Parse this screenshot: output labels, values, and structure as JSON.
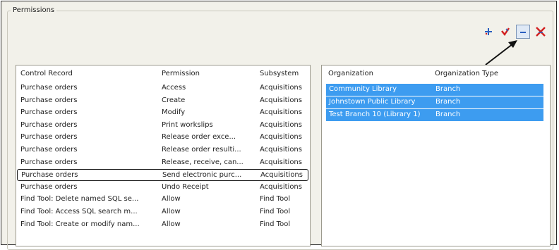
{
  "group": {
    "title": "Permissions"
  },
  "toolbar": {
    "buttons": [
      {
        "name": "add-icon",
        "color": "#2b5fbf"
      },
      {
        "name": "edit-check-icon",
        "color": "#d21f1f"
      },
      {
        "name": "remove-icon",
        "color": "#2b5fbf"
      },
      {
        "name": "delete-all-icon",
        "color": "#d21f1f"
      }
    ]
  },
  "left_table": {
    "columns": [
      "Control Record",
      "Permission",
      "Subsystem"
    ],
    "rows": [
      [
        "Purchase orders",
        "Access",
        "Acquisitions"
      ],
      [
        "Purchase orders",
        "Create",
        "Acquisitions"
      ],
      [
        "Purchase orders",
        "Modify",
        "Acquisitions"
      ],
      [
        "Purchase orders",
        "Print workslips",
        "Acquisitions"
      ],
      [
        "Purchase orders",
        "Release order exce...",
        "Acquisitions"
      ],
      [
        "Purchase orders",
        "Release order resulti...",
        "Acquisitions"
      ],
      [
        "Purchase orders",
        "Release, receive, can...",
        "Acquisitions"
      ],
      [
        "Purchase orders",
        "Send electronic purc...",
        "Acquisitions"
      ],
      [
        "Purchase orders",
        "Undo Receipt",
        "Acquisitions"
      ],
      [
        "Find Tool: Delete named SQL se...",
        "Allow",
        "Find Tool"
      ],
      [
        "Find Tool: Access SQL search m...",
        "Allow",
        "Find Tool"
      ],
      [
        "Find Tool: Create or modify nam...",
        "Allow",
        "Find Tool"
      ]
    ],
    "outlined_row": 7
  },
  "right_table": {
    "columns": [
      "Organization",
      "Organization Type"
    ],
    "rows": [
      [
        "Community Library",
        "Branch"
      ],
      [
        "Johnstown Public Library",
        "Branch"
      ],
      [
        "Test Branch 10 (Library 1)",
        "Branch"
      ]
    ],
    "selection_color": "#3d9cf0"
  }
}
